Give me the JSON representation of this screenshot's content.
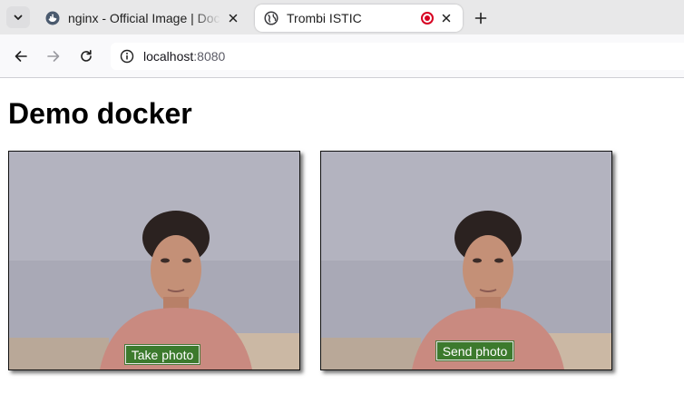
{
  "browser": {
    "tabs": [
      {
        "title": "nginx - Official Image | Docker Hub",
        "active": false,
        "favicon": "docker-icon"
      },
      {
        "title": "Trombi ISTIC",
        "active": true,
        "favicon": "globe-icon",
        "recording": true
      }
    ],
    "url": {
      "host": "localhost",
      "port": ":8080"
    }
  },
  "page": {
    "heading": "Demo docker",
    "camera_panel": {
      "button_label": "Take photo"
    },
    "photo_panel": {
      "button_label": "Send photo"
    }
  },
  "colors": {
    "button_green": "#3c7a2d",
    "record_red": "#d70022"
  }
}
